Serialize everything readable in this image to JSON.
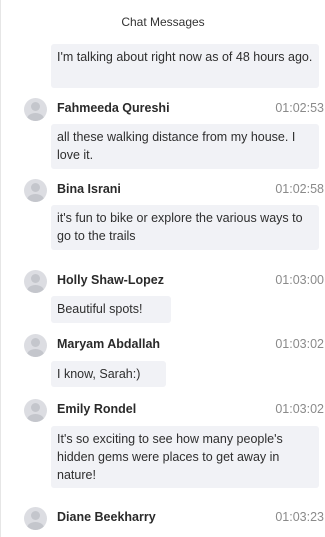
{
  "header": {
    "title": "Chat Messages"
  },
  "messages": [
    {
      "sender": "",
      "time": "",
      "text": "I'm talking about right now as of 48 hours ago."
    },
    {
      "sender": "Fahmeeda Qureshi",
      "time": "01:02:53",
      "text": "all these walking distance from my house. I love it."
    },
    {
      "sender": "Bina Israni",
      "time": "01:02:58",
      "text": "it's fun to bike or explore the various ways to go to the trails"
    },
    {
      "sender": "Holly Shaw-Lopez",
      "time": "01:03:00",
      "text": "Beautiful spots!"
    },
    {
      "sender": "Maryam Abdallah",
      "time": "01:03:02",
      "text": "I know, Sarah:)"
    },
    {
      "sender": "Emily Rondel",
      "time": "01:03:02",
      "text": "It's so exciting to see how many people's hidden gems were places to get away in nature!"
    },
    {
      "sender": "Diane Beekharry",
      "time": "01:03:23",
      "text": ""
    }
  ]
}
